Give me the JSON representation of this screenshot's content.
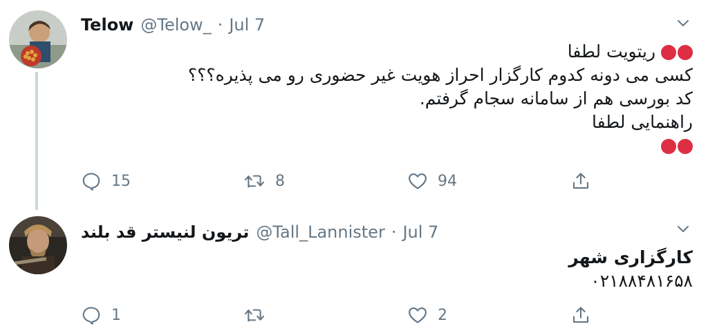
{
  "tweets": [
    {
      "name": "Telow",
      "handle": "@Telow_",
      "separator": "·",
      "date": "Jul 7",
      "lines": [
        "ریتویت لطفا",
        "کسی می دونه کدوم کارگزار احراز هویت غیر حضوری رو می پذیره؟؟؟",
        "کد بورسی هم از سامانه سجام گرفتم.",
        "راهنمایی لطفا"
      ],
      "emoji": "red-circle",
      "replies": "15",
      "retweets": "8",
      "likes": "94"
    },
    {
      "name": "تریون لنیستر قد بلند",
      "handle": "@Tall_Lannister",
      "separator": "·",
      "date": "Jul 7",
      "lines": [
        "کارگزاری شهر",
        "۰۲۱۸۸۴۸۱۶۵۸"
      ],
      "replies": "1",
      "retweets": "",
      "likes": "2"
    }
  ],
  "colors": {
    "text": "#14171a",
    "secondary": "#657786",
    "thread_line": "#ccd6dd",
    "emoji_red": "#dd2e44"
  },
  "icons": [
    "reply-icon",
    "retweet-icon",
    "like-icon",
    "share-icon",
    "caret-down-icon"
  ]
}
